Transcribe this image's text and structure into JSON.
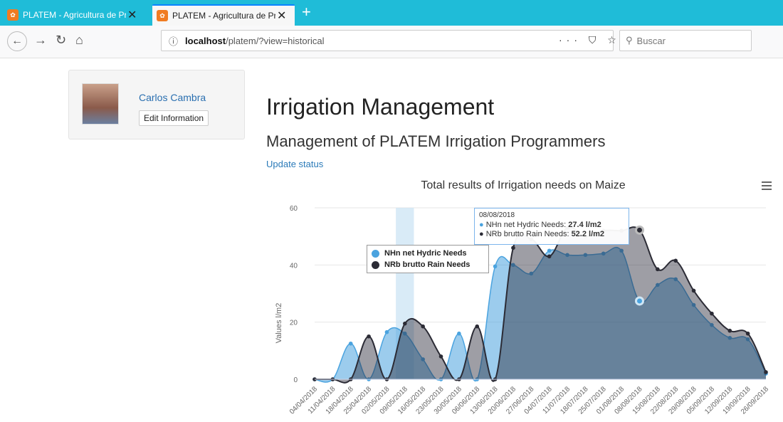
{
  "browser": {
    "tabs": [
      {
        "title": "PLATEM - Agricultura de Precisi"
      },
      {
        "title": "PLATEM - Agricultura de Precisi"
      }
    ],
    "url_host": "localhost",
    "url_path": "/platem/?view=historical",
    "search_placeholder": "Buscar"
  },
  "profile": {
    "name": "Carlos Cambra",
    "edit_label": "Edit Information"
  },
  "page": {
    "title": "Irrigation Management",
    "subtitle": "Management of PLATEM Irrigation Programmers",
    "update_link": "Update status"
  },
  "tooltip": {
    "date": "08/08/2018",
    "net_label": "NHn net Hydric Needs:",
    "net_value": "27.4 l/m2",
    "brutto_label": "NRb brutto Rain Needs:",
    "brutto_value": "52.2 l/m2"
  },
  "chart_data": {
    "type": "area",
    "title": "Total results of Irrigation needs on Maize",
    "ylabel": "Values l/m2",
    "ylim": [
      0,
      60
    ],
    "yticks": [
      0,
      20,
      40,
      60
    ],
    "categories": [
      "04/04/2018",
      "11/04/2018",
      "18/04/2018",
      "25/04/2018",
      "02/05/2018",
      "09/05/2018",
      "16/05/2018",
      "23/05/2018",
      "30/05/2018",
      "06/06/2018",
      "13/06/2018",
      "20/06/2018",
      "27/06/2018",
      "04/07/2018",
      "11/07/2018",
      "18/07/2018",
      "25/07/2018",
      "01/08/2018",
      "08/08/2018",
      "15/08/2018",
      "22/08/2018",
      "29/08/2018",
      "05/09/2018",
      "12/09/2018",
      "19/09/2018",
      "26/09/2018"
    ],
    "series": [
      {
        "name": "NHn net Hydric Needs",
        "color": "#4aa3df",
        "values": [
          0,
          0,
          12.5,
          0,
          16.5,
          16,
          7,
          0,
          16,
          0,
          39.5,
          40,
          37,
          45,
          43.5,
          43.5,
          44,
          45,
          27.4,
          33,
          35,
          26,
          19,
          14.5,
          14,
          2
        ]
      },
      {
        "name": "NRb brutto Rain Needs",
        "color": "#2b2b35",
        "values": [
          0,
          0,
          0,
          15,
          0,
          19.5,
          18.5,
          8,
          0,
          18.5,
          0,
          46,
          49,
          43,
          53,
          50,
          52,
          52,
          52.2,
          38.5,
          41.5,
          31,
          23,
          17,
          16,
          2.5
        ]
      }
    ],
    "highlight_category": "09/05/2018"
  }
}
